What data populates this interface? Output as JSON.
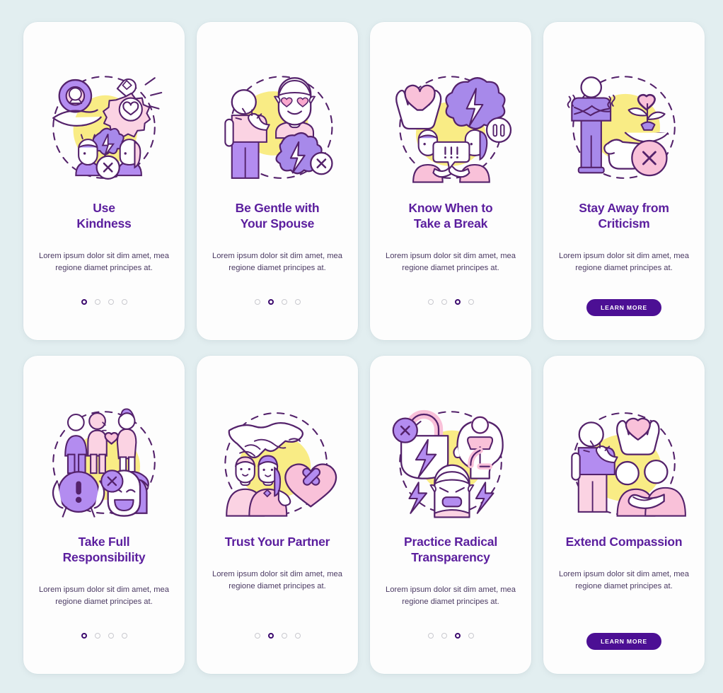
{
  "page": {
    "background_color": "#e2eef0",
    "card_background": "#fdfdfd",
    "title_color": "#5b1e9e",
    "body_color": "#4b3a63",
    "accent_purple": "#4c0f94",
    "dot_active_color": "#3c0a6e",
    "dot_inactive_color": "#c9c9cf",
    "palette": {
      "outline": "#54226b",
      "light_purple": "#a789ea",
      "mid_purple": "#b38cf0",
      "pink": "#f9c1d9",
      "light_pink": "#fbd3e3",
      "yellow": "#f7ea7e",
      "white": "#ffffff"
    }
  },
  "body_text": "Lorem ipsum dolor sit dim amet, mea regione diamet principes at.",
  "learn_more_label": "LEARN MORE",
  "cards": [
    {
      "id": "use-kindness",
      "title_lines": [
        "Use",
        "Kindness"
      ],
      "title": "Use Kindness",
      "body": "Lorem ipsum dolor sit dim amet, mea regione diamet principes at.",
      "footer_type": "dots",
      "dots_total": 4,
      "dots_active_index": 0,
      "illustration": "kindness-illustration"
    },
    {
      "id": "be-gentle-with-your-spouse",
      "title_lines": [
        "Be Gentle with",
        "Your Spouse"
      ],
      "title": "Be Gentle with Your Spouse",
      "body": "Lorem ipsum dolor sit dim amet, mea regione diamet principes at.",
      "footer_type": "dots",
      "dots_total": 4,
      "dots_active_index": 1,
      "illustration": "gentle-spouse-illustration"
    },
    {
      "id": "know-when-to-take-a-break",
      "title_lines": [
        "Know When to",
        "Take a Break"
      ],
      "title": "Know When to Take a Break",
      "body": "Lorem ipsum dolor sit dim amet, mea regione diamet principes at.",
      "footer_type": "dots",
      "dots_total": 4,
      "dots_active_index": 2,
      "illustration": "take-a-break-illustration"
    },
    {
      "id": "stay-away-from-criticism",
      "title_lines": [
        "Stay Away from",
        "Criticism"
      ],
      "title": "Stay Away from Criticism",
      "body": "Lorem ipsum dolor sit dim amet, mea regione diamet principes at.",
      "footer_type": "button",
      "button_label": "LEARN MORE",
      "illustration": "criticism-illustration"
    },
    {
      "id": "take-full-responsibility",
      "title_lines": [
        "Take Full",
        "Responsibility"
      ],
      "title": "Take Full Responsibility",
      "body": "Lorem ipsum dolor sit dim amet, mea regione diamet principes at.",
      "footer_type": "dots",
      "dots_total": 4,
      "dots_active_index": 0,
      "illustration": "responsibility-illustration"
    },
    {
      "id": "trust-your-partner",
      "title_lines": [
        "Trust Your Partner"
      ],
      "title": "Trust Your Partner",
      "body": "Lorem ipsum dolor sit dim amet, mea regione diamet principes at.",
      "footer_type": "dots",
      "dots_total": 4,
      "dots_active_index": 1,
      "illustration": "trust-illustration"
    },
    {
      "id": "practice-radical-transparency",
      "title_lines": [
        "Practice Radical",
        "Transparency"
      ],
      "title": "Practice Radical Transparency",
      "body": "Lorem ipsum dolor sit dim amet, mea regione diamet principes at.",
      "footer_type": "dots",
      "dots_total": 4,
      "dots_active_index": 2,
      "illustration": "transparency-illustration"
    },
    {
      "id": "extend-compassion",
      "title_lines": [
        "Extend Compassion"
      ],
      "title": "Extend Compassion",
      "body": "Lorem ipsum dolor sit dim amet, mea regione diamet principes at.",
      "footer_type": "button",
      "button_label": "LEARN MORE",
      "illustration": "compassion-illustration"
    }
  ]
}
